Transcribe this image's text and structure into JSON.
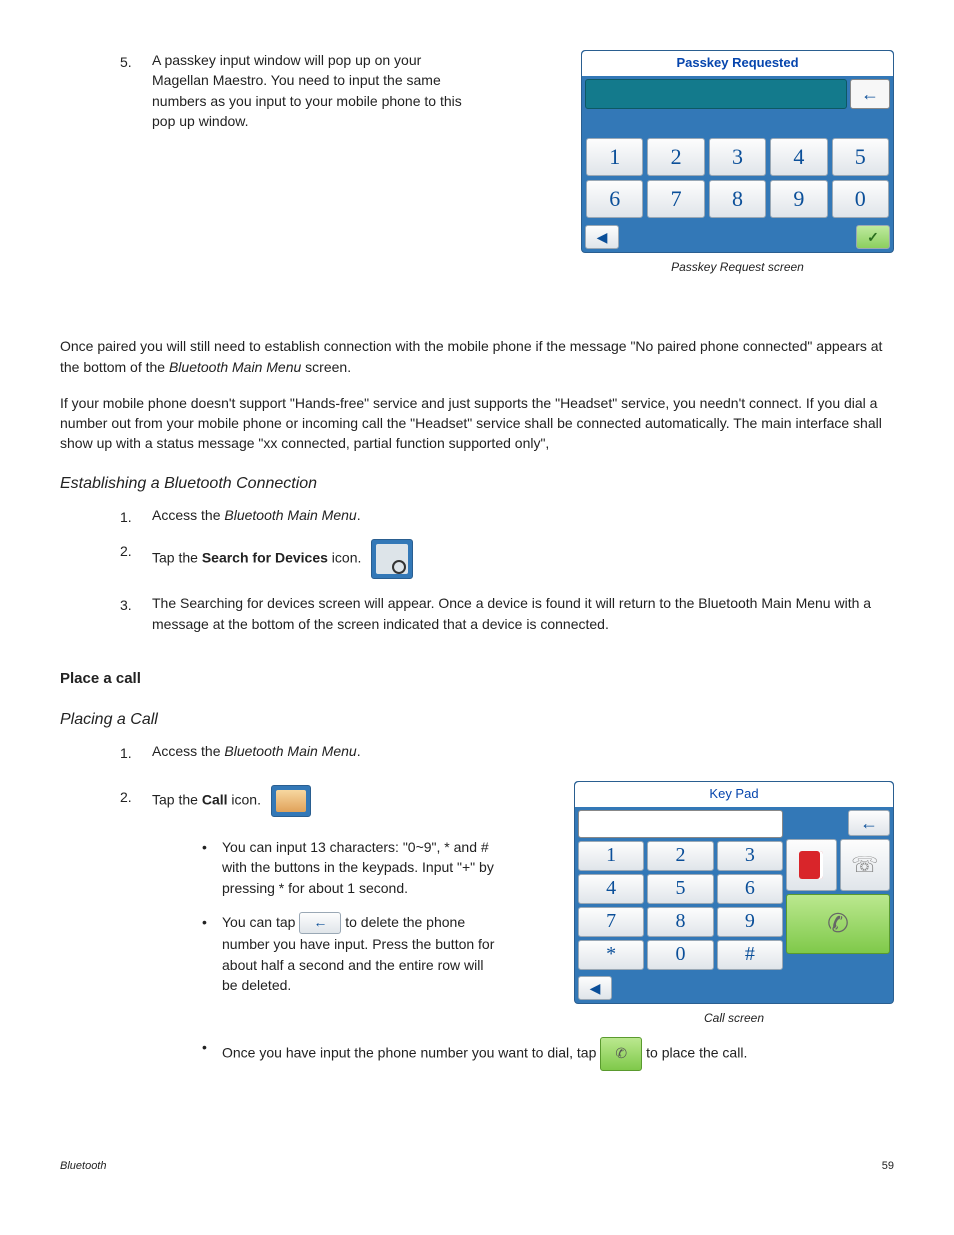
{
  "step5": {
    "num": "5.",
    "text": "A passkey input window will pop up on your Magellan Maestro. You need to input the same numbers as you input to your mobile phone to this pop up window."
  },
  "passkey_screen": {
    "title": "Passkey Requested",
    "back": "←",
    "keys": [
      "1",
      "2",
      "3",
      "4",
      "5",
      "6",
      "7",
      "8",
      "9",
      "0"
    ],
    "footer_back": "◀",
    "footer_ok": "✓",
    "caption": "Passkey Request screen"
  },
  "para1a": "Once paired you will still need to establish connection with the mobile phone if the message \"No paired phone connected\" appears at the bottom of the ",
  "para1b": "Bluetooth Main Menu",
  "para1c": " screen.",
  "para2": "If your mobile phone doesn't support \"Hands-free\" service and just supports the \"Headset\" service, you needn't connect. If you dial a number out from your mobile phone or incoming call the \"Headset\" service shall be connected automatically. The main interface shall show up with a status message \"xx connected, partial function supported only\",",
  "est_heading": "Establishing a Bluetooth Connection",
  "est_step1": {
    "num": "1.",
    "a": "Access the ",
    "b": "Bluetooth Main Menu",
    "c": "."
  },
  "est_step2": {
    "num": "2.",
    "a": "Tap the ",
    "b": "Search for Devices",
    "c": " icon."
  },
  "est_step3": {
    "num": "3.",
    "text": "The Searching for devices screen will appear.  Once a device is found it will return to the Bluetooth Main Menu with a message at the bottom of the screen indicated that a device is connected."
  },
  "place_heading": "Place a call",
  "placing_heading": "Placing a Call",
  "pl_step1": {
    "num": "1.",
    "a": "Access the ",
    "b": "Bluetooth Main Menu",
    "c": "."
  },
  "pl_step2": {
    "num": "2.",
    "a": "Tap the ",
    "b": "Call",
    "c": " icon."
  },
  "keypad_screen": {
    "title": "Key Pad",
    "keys": [
      "1",
      "2",
      "3",
      "4",
      "5",
      "6",
      "7",
      "8",
      "9",
      "*",
      "0",
      "#"
    ],
    "back": "←",
    "footer_back": "◀",
    "caption": "Call screen",
    "phone_glyph": "✆"
  },
  "bullet1": "You can input 13 characters: \"0~9\", * and # with the buttons in the keypads. Input \"+\" by pressing * for about 1 second.",
  "bullet2a": "You can tap ",
  "bullet2_arrow": "←",
  "bullet2b": " to delete the phone number you have input. Press the button for about half a second and the entire row will be deleted.",
  "bullet3a": "Once you have input the phone number you want to dial, tap ",
  "bullet3_glyph": "✆",
  "bullet3b": " to place the call.",
  "footer_left": "Bluetooth",
  "footer_right": "59"
}
